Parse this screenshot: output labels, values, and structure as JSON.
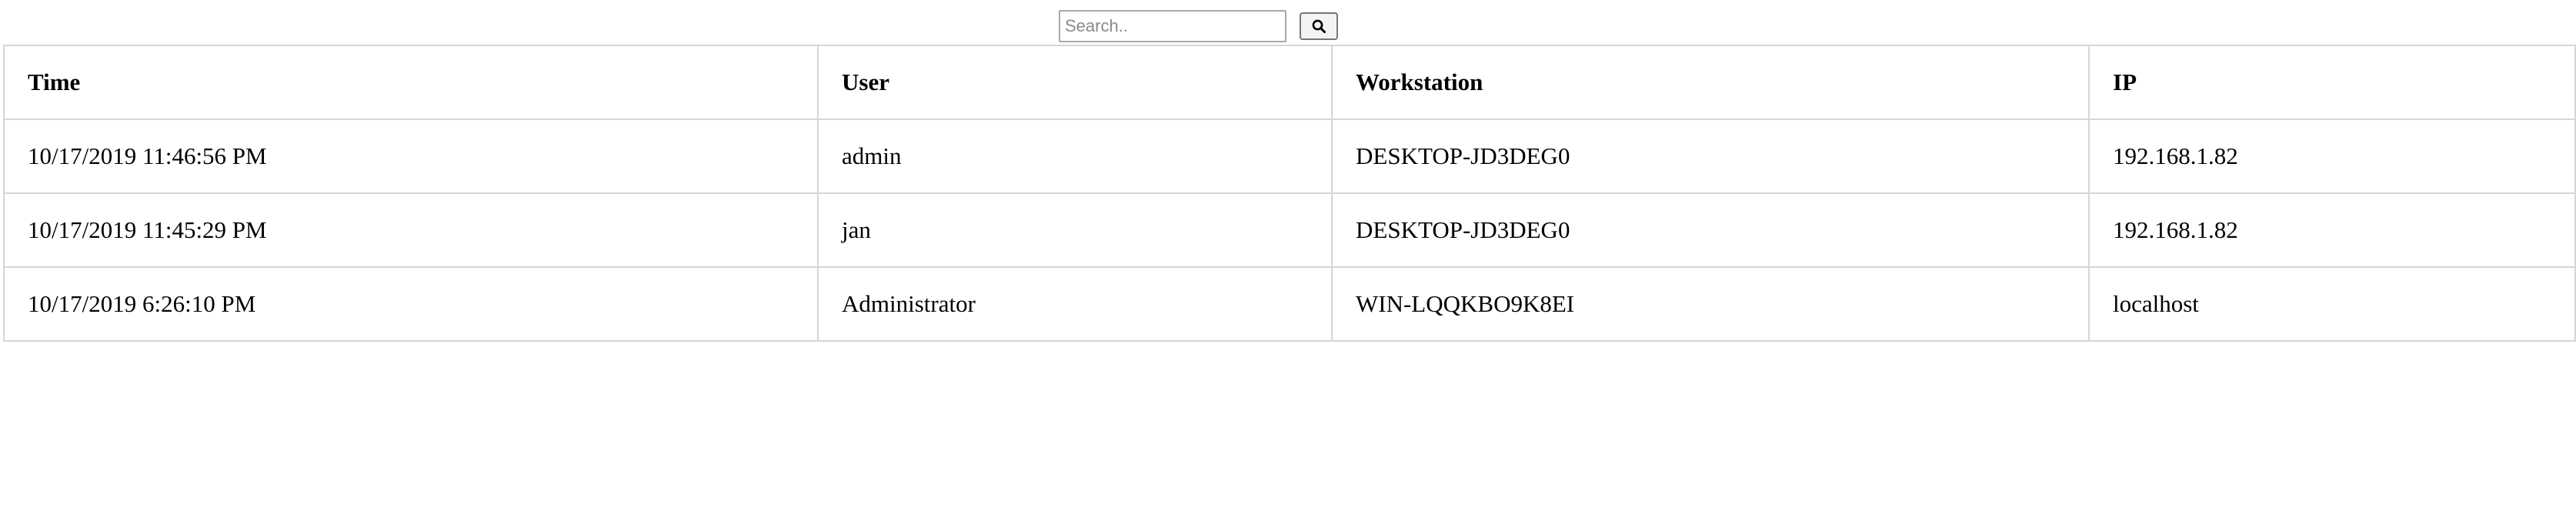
{
  "search": {
    "placeholder": "Search..",
    "value": "",
    "button_icon": "search-icon"
  },
  "table": {
    "columns": [
      "Time",
      "User",
      "Workstation",
      "IP"
    ],
    "rows": [
      [
        "10/17/2019 11:46:56 PM",
        "admin",
        "DESKTOP-JD3DEG0",
        "192.168.1.82"
      ],
      [
        "10/17/2019 11:45:29 PM",
        "jan",
        "DESKTOP-JD3DEG0",
        "192.168.1.82"
      ],
      [
        "10/17/2019 6:26:10 PM",
        "Administrator",
        "WIN-LQQKBO9K8EI",
        "localhost"
      ]
    ]
  }
}
